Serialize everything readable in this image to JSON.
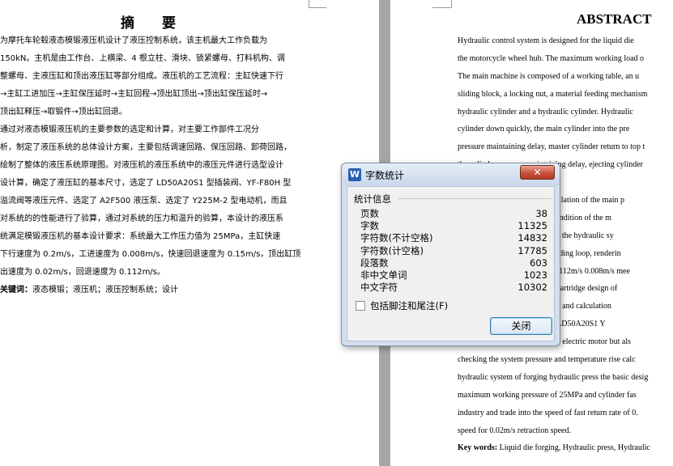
{
  "document": {
    "cn_title": "摘   要",
    "cn_lines": [
      "    为摩托车轮毂液态模锻液压机设计了液压控制系统，该主机最大工作负载为",
      "150kN。主机是由工作台、上横梁、4 根立柱、滑块、锁紧螺母、打料机构、调",
      "整螺母、主液压缸和顶出液压缸等部分组成。液压机的工艺流程：主缸快速下行",
      "→主缸工进加压→主缸保压延时→主缸回程→顶出缸顶出→顶出缸保压延时→",
      "顶出缸释压→取锻件→顶出缸回退。",
      "    通过对液态模锻液压机的主要参数的选定和计算，对主要工作部件工况分",
      "析，制定了液压系统的总体设计方案，主要包括调速回路、保压回路、卸荷回路，",
      "绘制了整体的液压系统原理图。对液压机的液压系统中的液压元件进行选型设计",
      "设计算，确定了液压缸的基本尺寸，选定了 LD50A20S1 型插装阀、YF-F80H 型",
      "溢流阀等液压元件、选定了 A2F500 液压泵、选定了 Y225M-2 型电动机，而且",
      "对系统的的性能进行了验算，通过对系统的压力和温升的验算，本设计的液压系",
      "统满足模锻液压机的基本设计要求：系统最大工作压力值为 25MPa，主缸快速",
      "下行速度为 0.2m/s，工进速度为 0.008m/s，快速回退速度为 0.15m/s，顶出缸顶",
      "出速度为 0.02m/s，回退速度为 0.112m/s。"
    ],
    "cn_keywords_label": "关键词：",
    "cn_keywords": "液态模锻；液压机；液压控制系统；设计",
    "en_title": "ABSTRACT",
    "en_lines": [
      "    Hydraulic control system is designed for the liquid die",
      "the motorcycle wheel hub. The maximum working load o",
      "The main machine is composed of a working table, an u",
      "sliding block, a locking nut, a material feeding mechanism",
      "hydraulic cylinder and a hydraulic cylinder. Hydraulic",
      "cylinder down quickly, the main cylinder into the pre",
      "pressure maintaining delay, master cylinder return to top t",
      "the cylinder pressure maintaining delay, ejecting cylinder",
      "forging, ejection cylinder back.",
      "    Through the selection and calculation of the main p",
      "hydraulic press, the working condition of the m",
      "analyzed, the overall scheme of the hydraulic sy",
      "pressure maintaining and unloading loop, renderin",
      "hydraulic system as a whole. 0.112m/s 0.008m/s mee",
      "the type selection of the valve cartridge design of",
      "hydraulic components selection and calculation",
      "cylinder size, and selected the LD50A20S1 Y",
      "hydraulic pump, Y225M-2 type electric motor but als",
      "checking the system pressure and temperature rise calc",
      "hydraulic system of forging hydraulic press the basic desig",
      "maximum working pressure of 25MPa and cylinder fas",
      "industry and trade into the speed of fast return rate of 0.",
      "speed for 0.02m/s retraction speed."
    ],
    "en_keywords_label": "Key words:",
    "en_keywords": "Liquid die forging, Hydraulic press, Hydraulic"
  },
  "dialog": {
    "icon_letter": "W",
    "title": "字数统计",
    "close_glyph": "✕",
    "group_label": "统计信息",
    "stats": [
      {
        "label": "页数",
        "value": "38"
      },
      {
        "label": "字数",
        "value": "11325"
      },
      {
        "label": "字符数(不计空格)",
        "value": "14832"
      },
      {
        "label": "字符数(计空格)",
        "value": "17785"
      },
      {
        "label": "段落数",
        "value": "603"
      },
      {
        "label": "非中文单词",
        "value": "1023"
      },
      {
        "label": "中文字符",
        "value": "10302"
      }
    ],
    "checkbox_label": "包括脚注和尾注(F)",
    "checkbox_checked": false,
    "close_button": "关闭"
  }
}
